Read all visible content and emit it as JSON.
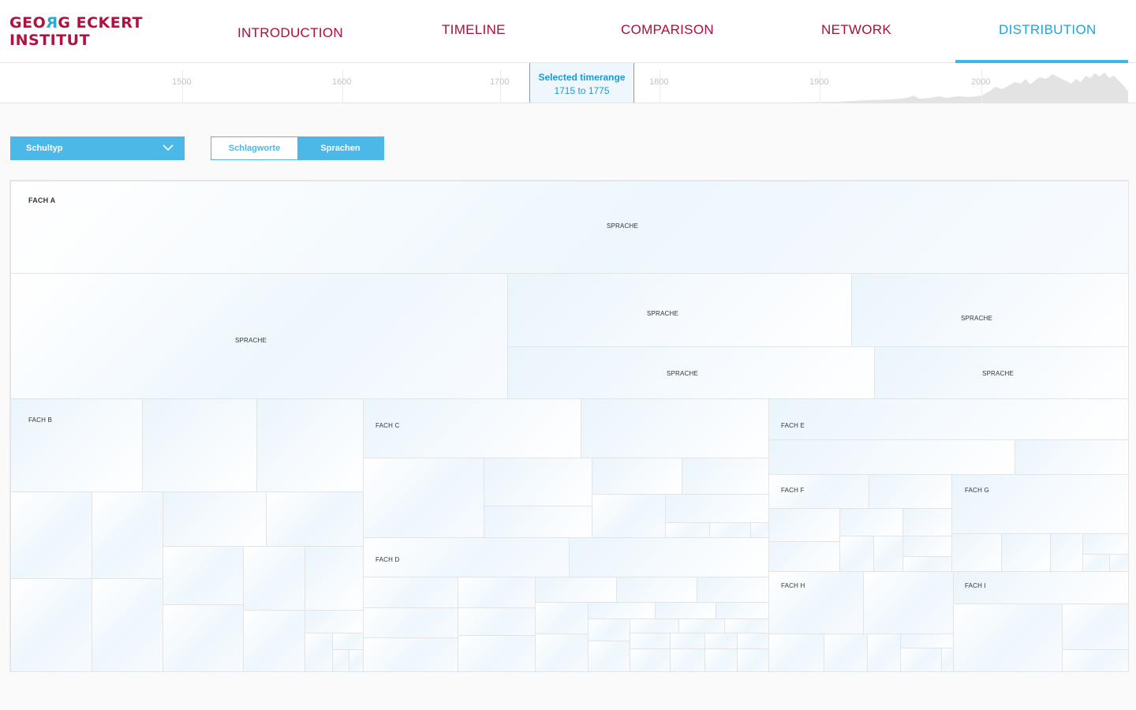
{
  "logo": {
    "line1a": "GEO",
    "line1flip": "R",
    "line1b": "G ECKERT",
    "line2": "INSTITUT"
  },
  "nav": [
    {
      "label": "INTRODUCTION"
    },
    {
      "label": "TIMELINE"
    },
    {
      "label": "COMPARISON"
    },
    {
      "label": "NETWORK"
    },
    {
      "label": "DISTRIBUTION"
    }
  ],
  "timeline": {
    "ticks": [
      "1500",
      "1600",
      "1700",
      "1800",
      "1900",
      "2000"
    ],
    "selection_title": "Selected timerange",
    "selection_range": "1715 to 1775"
  },
  "controls": {
    "dropdown_value": "Schultyp",
    "toggle_left": "Schlagworte",
    "toggle_right": "Sprachen"
  },
  "treemap": {
    "fach_a": "FACH A",
    "fach_b": "FACH B",
    "fach_c": "FACH C",
    "fach_d": "FACH D",
    "fach_e": "FACH E",
    "fach_f": "FACH F",
    "fach_g": "FACH G",
    "fach_h": "FACH H",
    "fach_i": "FACH I",
    "sprache": "SPRACHE"
  },
  "colors": {
    "brand": "#b0123f",
    "accent": "#43b6e8",
    "active_nav": "#23a2d6"
  }
}
